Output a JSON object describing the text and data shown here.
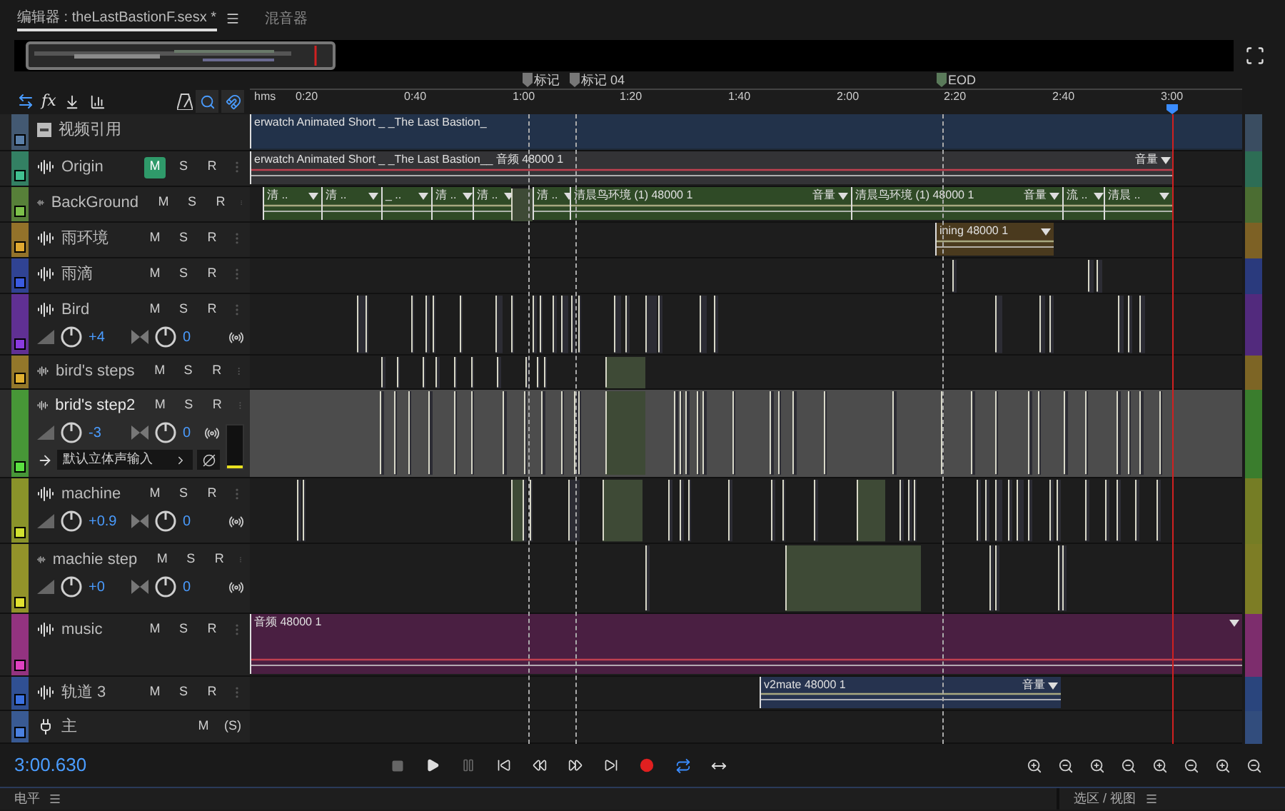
{
  "tabs": [
    {
      "label": "编辑器 : theLastBastionF.sesx *",
      "selected": true
    },
    {
      "label": "混音器",
      "selected": false
    }
  ],
  "toolbar": {
    "fx": "fx"
  },
  "markers": [
    {
      "label": "标记"
    },
    {
      "label": "标记 04"
    },
    {
      "label": "EOD"
    }
  ],
  "ruler": [
    "hms",
    "0:20",
    "0:40",
    "1:00",
    "1:20",
    "1:40",
    "2:00",
    "2:20",
    "2:40",
    "3:00"
  ],
  "tracks": [
    {
      "kind": "video",
      "name": "视频引用",
      "color": "#5a7fa8",
      "selected": false,
      "clips": [
        {
          "label": "erwatch Animated Short _ _The Last Bastion_"
        }
      ]
    },
    {
      "kind": "audio",
      "name": "Origin",
      "color": "#40c090",
      "selected": false,
      "buttons": [
        {
          "label": "M",
          "on": true
        },
        {
          "label": "S",
          "on": false
        },
        {
          "label": "R",
          "on": false
        }
      ],
      "clips": [
        {
          "label": "erwatch Animated Short _ _The Last Bastion__ 音频 48000 1",
          "gain": "音量"
        }
      ]
    },
    {
      "kind": "audio",
      "name": "BackGround",
      "color": "#7cc04a",
      "selected": false,
      "buttons": [
        {
          "label": "M",
          "on": false
        },
        {
          "label": "S",
          "on": false
        },
        {
          "label": "R",
          "on": false
        }
      ],
      "clips": [
        {
          "label": "清 .."
        },
        {
          "label": "清 .."
        },
        {
          "label": "_ .."
        },
        {
          "label": "清 .."
        },
        {
          "label": "清 .."
        },
        {
          "label": "清 .."
        },
        {
          "label": "清晨鸟环境 (1) 48000 1",
          "gain": "音量"
        },
        {
          "label": "清晨鸟环境 (1) 48000 1",
          "gain": "音量"
        },
        {
          "label": "流 .."
        },
        {
          "label": "清晨 .."
        }
      ]
    },
    {
      "kind": "audio",
      "name": "雨环境",
      "color": "#e0a830",
      "selected": false,
      "buttons": [
        {
          "label": "M",
          "on": false
        },
        {
          "label": "S",
          "on": false
        },
        {
          "label": "R",
          "on": false
        }
      ],
      "clips": [
        {
          "label": "ining 48000 1"
        }
      ]
    },
    {
      "kind": "audio",
      "name": "雨滴",
      "color": "#3a5ae0",
      "selected": false,
      "buttons": [
        {
          "label": "M",
          "on": false
        },
        {
          "label": "S",
          "on": false
        },
        {
          "label": "R",
          "on": false
        }
      ]
    },
    {
      "kind": "audio",
      "name": "Bird",
      "color": "#8a3ae0",
      "selected": false,
      "buttons": [
        {
          "label": "M",
          "on": false
        },
        {
          "label": "S",
          "on": false
        },
        {
          "label": "R",
          "on": false
        }
      ],
      "volume": "+4",
      "pan": "0"
    },
    {
      "kind": "audio",
      "name": "bird's steps",
      "color": "#e0b030",
      "selected": false,
      "buttons": [
        {
          "label": "M",
          "on": false
        },
        {
          "label": "S",
          "on": false
        },
        {
          "label": "R",
          "on": false
        }
      ]
    },
    {
      "kind": "audio",
      "name": "brid's step2",
      "color": "#5ae040",
      "selected": true,
      "buttons": [
        {
          "label": "M",
          "on": false
        },
        {
          "label": "S",
          "on": false
        },
        {
          "label": "R",
          "on": false
        }
      ],
      "volume": "-3",
      "pan": "0",
      "input": "默认立体声输入",
      "meter": {
        "level": 0.08
      }
    },
    {
      "kind": "audio",
      "name": "machine",
      "color": "#d0e030",
      "selected": false,
      "buttons": [
        {
          "label": "M",
          "on": false
        },
        {
          "label": "S",
          "on": false
        },
        {
          "label": "R",
          "on": false
        }
      ],
      "volume": "+0.9",
      "pan": "0"
    },
    {
      "kind": "audio",
      "name": "machie step",
      "color": "#e0e030",
      "selected": false,
      "buttons": [
        {
          "label": "M",
          "on": false
        },
        {
          "label": "S",
          "on": false
        },
        {
          "label": "R",
          "on": false
        }
      ],
      "volume": "+0",
      "pan": "0"
    },
    {
      "kind": "audio",
      "name": "music",
      "color": "#e040c0",
      "selected": false,
      "buttons": [
        {
          "label": "M",
          "on": false
        },
        {
          "label": "S",
          "on": false
        },
        {
          "label": "R",
          "on": false
        }
      ],
      "clips": [
        {
          "label": "音频 48000 1"
        }
      ]
    },
    {
      "kind": "audio",
      "name": "轨道 3",
      "color": "#3a70e0",
      "selected": false,
      "buttons": [
        {
          "label": "M",
          "on": false
        },
        {
          "label": "S",
          "on": false
        },
        {
          "label": "R",
          "on": false
        }
      ],
      "clips": [
        {
          "label": "v2mate 48000 1",
          "gain": "音量"
        }
      ]
    },
    {
      "kind": "master",
      "name": "主",
      "color": "#4a80e0",
      "selected": false,
      "buttons": [
        {
          "label": "M",
          "on": false
        },
        {
          "label": "(S)",
          "on": false
        }
      ]
    }
  ],
  "time": "3:00.630",
  "panels": [
    {
      "title": "电平"
    },
    {
      "title": "选区 / 视图"
    }
  ]
}
